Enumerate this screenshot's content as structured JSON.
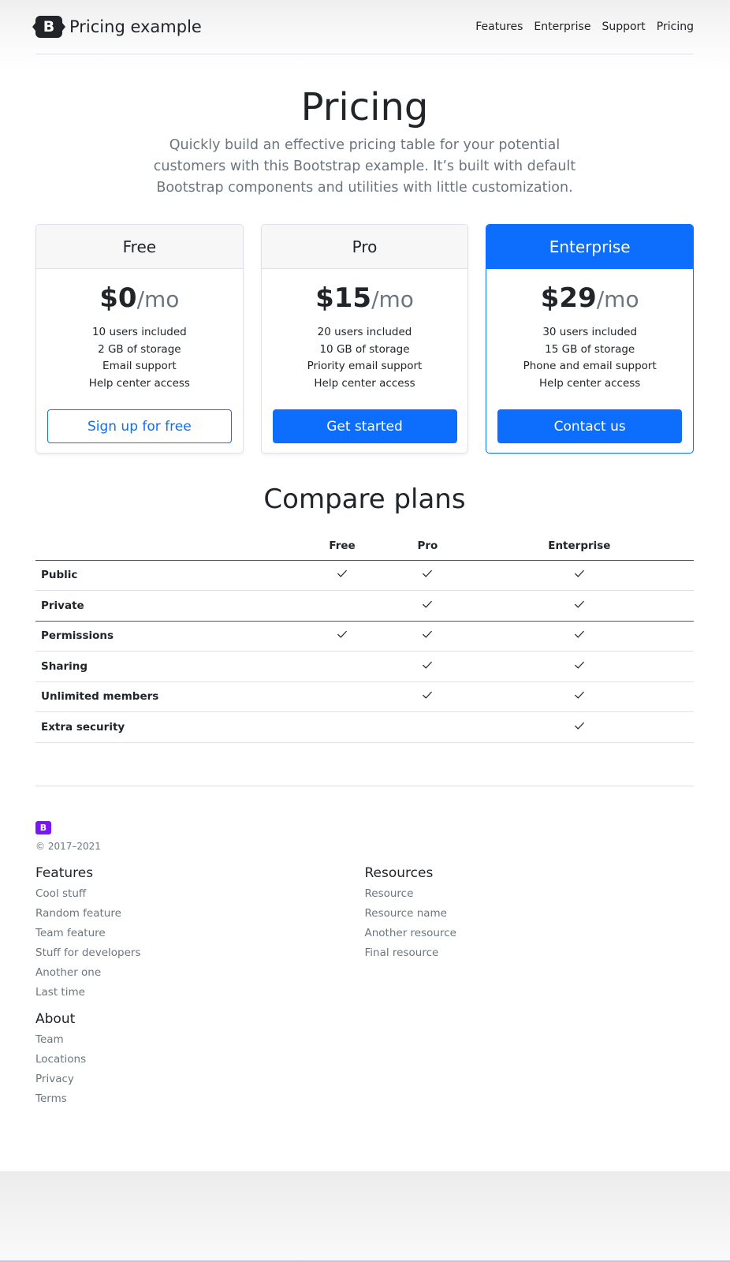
{
  "header": {
    "brand_letter": "B",
    "brand_text": "Pricing example",
    "nav": [
      "Features",
      "Enterprise",
      "Support",
      "Pricing"
    ]
  },
  "hero": {
    "title": "Pricing",
    "lead": "Quickly build an effective pricing table for your potential customers with this Bootstrap example. It’s built with default Bootstrap components and utilities with little customization."
  },
  "plans": [
    {
      "name": "Free",
      "price": "$0",
      "per": "/mo",
      "features": [
        "10 users included",
        "2 GB of storage",
        "Email support",
        "Help center access"
      ],
      "button": "Sign up for free"
    },
    {
      "name": "Pro",
      "price": "$15",
      "per": "/mo",
      "features": [
        "20 users included",
        "10 GB of storage",
        "Priority email support",
        "Help center access"
      ],
      "button": "Get started"
    },
    {
      "name": "Enterprise",
      "price": "$29",
      "per": "/mo",
      "features": [
        "30 users included",
        "15 GB of storage",
        "Phone and email support",
        "Help center access"
      ],
      "button": "Contact us"
    }
  ],
  "compare": {
    "title": "Compare plans",
    "columns": [
      "Free",
      "Pro",
      "Enterprise"
    ],
    "rows": [
      {
        "label": "Public",
        "checks": [
          true,
          true,
          true
        ]
      },
      {
        "label": "Private",
        "checks": [
          false,
          true,
          true
        ]
      },
      {
        "label": "Permissions",
        "checks": [
          true,
          true,
          true
        ]
      },
      {
        "label": "Sharing",
        "checks": [
          false,
          true,
          true
        ]
      },
      {
        "label": "Unlimited members",
        "checks": [
          false,
          true,
          true
        ]
      },
      {
        "label": "Extra security",
        "checks": [
          false,
          false,
          true
        ]
      }
    ]
  },
  "footer": {
    "logo_letter": "B",
    "copyright": "© 2017–2021",
    "features": {
      "title": "Features",
      "links": [
        "Cool stuff",
        "Random feature",
        "Team feature",
        "Stuff for developers",
        "Another one",
        "Last time"
      ]
    },
    "resources": {
      "title": "Resources",
      "links": [
        "Resource",
        "Resource name",
        "Another resource",
        "Final resource"
      ]
    },
    "about": {
      "title": "About",
      "links": [
        "Team",
        "Locations",
        "Privacy",
        "Terms"
      ]
    }
  },
  "colors": {
    "primary": "#0d6efd",
    "footer_logo": "#7a17f2",
    "muted": "#6c757d"
  },
  "icons": {
    "check": "check-icon"
  }
}
